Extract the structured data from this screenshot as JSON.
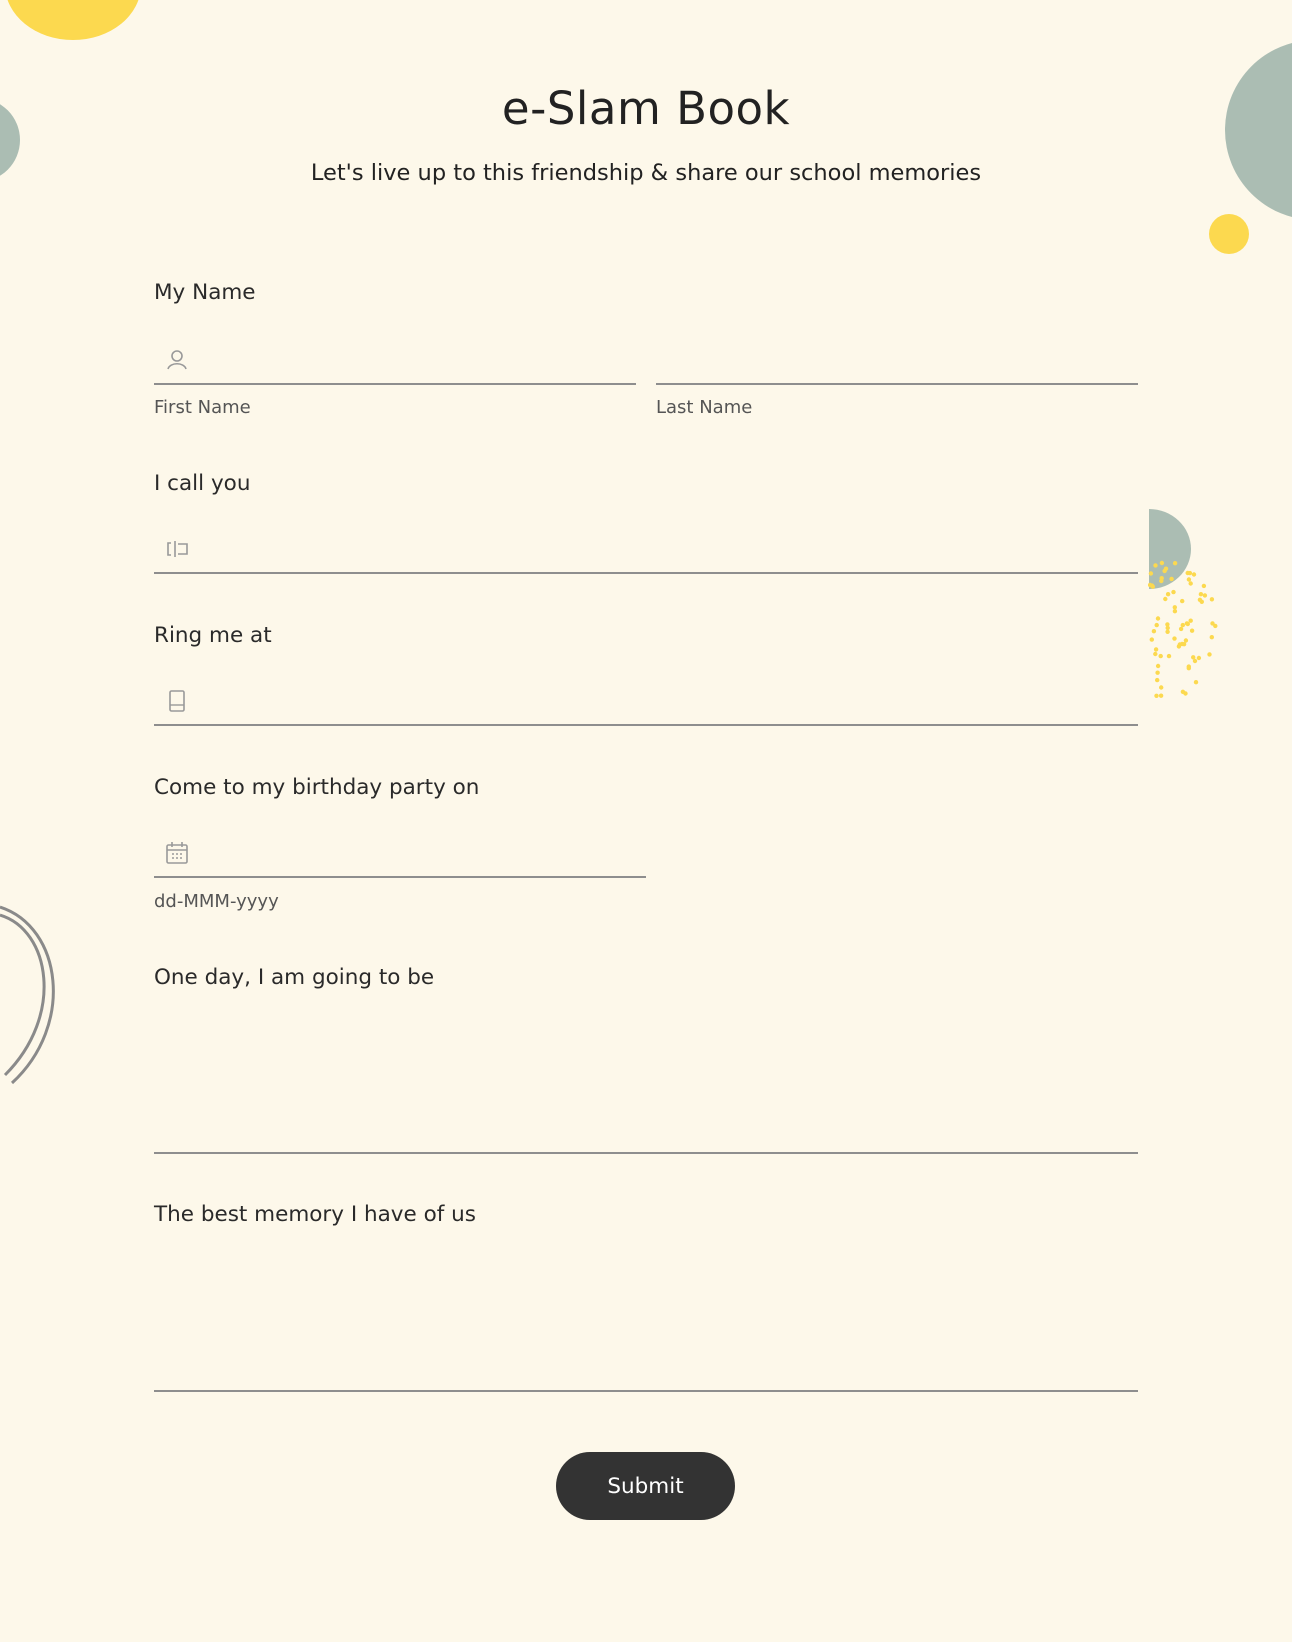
{
  "header": {
    "title": "e-Slam Book",
    "subtitle": "Let's live up to this friendship & share our school memories"
  },
  "fields": {
    "name": {
      "label": "My Name",
      "first_sublabel": "First Name",
      "last_sublabel": "Last Name",
      "first_value": "",
      "last_value": "",
      "icon": "person-icon"
    },
    "nickname": {
      "label": "I call you",
      "value": "",
      "icon": "text-cursor-icon"
    },
    "phone": {
      "label": "Ring me at",
      "value": "",
      "icon": "phone-icon"
    },
    "birthday": {
      "label": "Come to my birthday party on",
      "value": "",
      "sublabel": "dd-MMM-yyyy",
      "icon": "calendar-icon"
    },
    "future": {
      "label": "One day, I am going to be",
      "value": ""
    },
    "memory": {
      "label": "The best memory I have of us",
      "value": ""
    }
  },
  "submit": {
    "label": "Submit"
  },
  "colors": {
    "background": "#fdf8ea",
    "accent_yellow": "#fcd94f",
    "accent_sage": "#abbdb3",
    "button": "#333333",
    "line": "#8e8e8e"
  }
}
